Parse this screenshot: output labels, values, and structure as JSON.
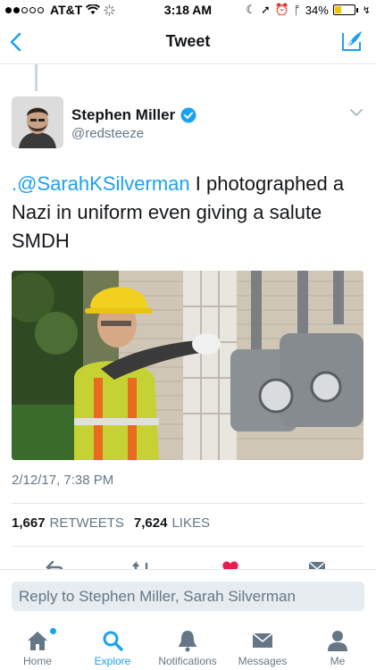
{
  "status_bar": {
    "carrier": "AT&T",
    "time": "3:18 AM",
    "battery": "34%",
    "battery_level": 0.34
  },
  "nav": {
    "title": "Tweet"
  },
  "tweet": {
    "author_name": "Stephen Miller",
    "author_handle": "@redsteeze",
    "mention": ".@SarahKSilverman",
    "text": " I photographed a Nazi in uniform even giving a salute SMDH",
    "timestamp": "2/12/17, 7:38 PM",
    "retweets_count": "1,667",
    "retweets_label": "RETWEETS",
    "likes_count": "7,624",
    "likes_label": "LIKES"
  },
  "reply": {
    "placeholder": "Reply to Stephen Miller, Sarah Silverman"
  },
  "tabs": [
    {
      "label": "Home",
      "icon": "home-icon"
    },
    {
      "label": "Explore",
      "icon": "search-icon"
    },
    {
      "label": "Notifications",
      "icon": "bell-icon"
    },
    {
      "label": "Messages",
      "icon": "envelope-icon"
    },
    {
      "label": "Me",
      "icon": "person-icon"
    }
  ],
  "colors": {
    "accent": "#1da1f2",
    "battery": "#f5c400",
    "muted": "#657786"
  }
}
